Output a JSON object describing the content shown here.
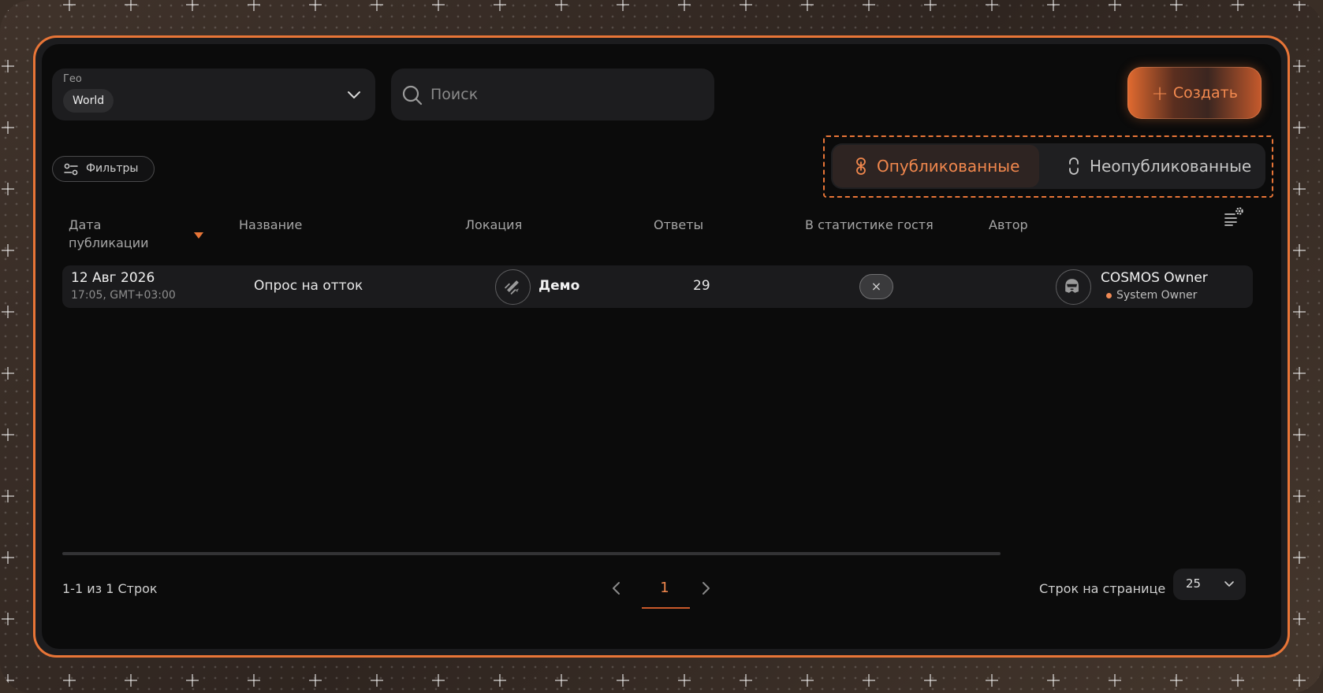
{
  "header": {
    "geo": {
      "label": "Гео",
      "value": "World"
    },
    "search": {
      "placeholder": "Поиск",
      "value": ""
    },
    "create_label": "Создать"
  },
  "filters_label": "Фильтры",
  "publish_toggle": {
    "published_label": "Опубликованные",
    "unpublished_label": "Неопубликованные",
    "active": "published"
  },
  "table": {
    "columns": {
      "date": "Дата публикации",
      "name": "Название",
      "location": "Локация",
      "answers": "Ответы",
      "guest_stats": "В статистике гостя",
      "author": "Автор"
    },
    "sorted_by": "date",
    "rows": [
      {
        "date": "12 Авг 2026",
        "time": "17:05, GMT+03:00",
        "name": "Опрос на отток",
        "location": "Демо",
        "answers": "29",
        "guest_stats": "×",
        "author_name": "COSMOS Owner",
        "author_role": "System Owner"
      }
    ]
  },
  "pagination": {
    "range_text": "1-1 из 1 Строк",
    "current_page": "1",
    "rows_per_page_label": "Строк на странице",
    "rows_per_page": "25"
  },
  "colors": {
    "accent": "#e87537",
    "panel": "#0b0b0b",
    "surface": "#1d1d1f"
  }
}
